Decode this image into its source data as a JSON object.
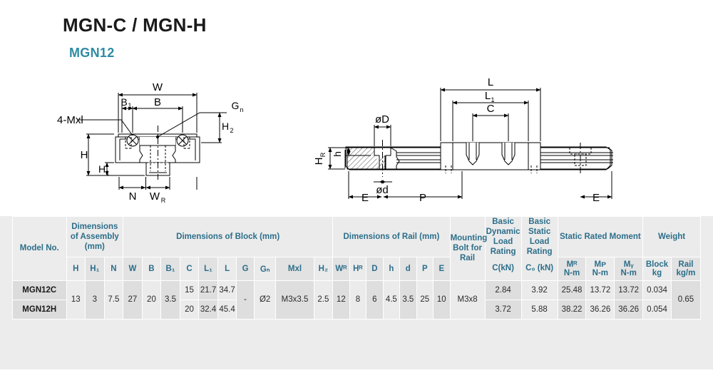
{
  "header": {
    "title": "MGN-C / MGN-H",
    "subtitle": "MGN12",
    "subtitle_color": "#2f8ba3"
  },
  "drawings": {
    "front_view": {
      "name": "block-cross-section",
      "labels": [
        "W",
        "B",
        "B₁",
        "Gₙ",
        "4-Mxl",
        "H₂",
        "H",
        "H₁",
        "N",
        "Wᴿ"
      ]
    },
    "side_view": {
      "name": "rail-side-view",
      "labels": [
        "L",
        "L₁",
        "C",
        "øD",
        "ød",
        "Hᴿ",
        "h",
        "E",
        "P",
        "E"
      ]
    }
  },
  "table": {
    "model_header": "Model No.",
    "groups": [
      {
        "label": "Dimensions of Assembly (mm)",
        "span": 3
      },
      {
        "label": "Dimensions of Block (mm)",
        "span": 10
      },
      {
        "label": "Dimensions of Rail (mm)",
        "span": 7
      },
      {
        "label": "Mounting Bolt for Rail",
        "span": 1
      },
      {
        "label": "Basic Dynamic Load Rating",
        "span": 1
      },
      {
        "label": "Basic Static Load Rating",
        "span": 1
      },
      {
        "label": "Static Rated Moment",
        "span": 3
      },
      {
        "label": "Weight",
        "span": 2
      }
    ],
    "sub_headers": [
      "H",
      "H₁",
      "N",
      "W",
      "B",
      "B₁",
      "C",
      "L₁",
      "L",
      "G",
      "Gₙ",
      "Mxl",
      "H₂",
      "Wᴿ",
      "Hᴿ",
      "D",
      "h",
      "d",
      "P",
      "E",
      "(mm)",
      "C(kN)",
      "C₀ (kN)",
      "Mᴿ",
      "Mᴘ",
      "Mᵧ",
      "Block",
      "Rail"
    ],
    "sub_units": {
      "MR": "N-m",
      "MP": "N-m",
      "MY": "N-m",
      "block": "kg",
      "rail": "kg/m"
    },
    "rows": [
      {
        "model": "MGN12C",
        "C": "15",
        "L1": "21.7",
        "L": "34.7",
        "Cd": "2.84",
        "C0": "3.92",
        "MR": "25.48",
        "MP": "13.72",
        "MY": "13.72",
        "block_weight": "0.034"
      },
      {
        "model": "MGN12H",
        "C": "20",
        "L1": "32.4",
        "L": "45.4",
        "Cd": "3.72",
        "C0": "5.88",
        "MR": "38.22",
        "MP": "36.26",
        "MY": "36.26",
        "block_weight": "0.054"
      }
    ],
    "shared": {
      "H": "13",
      "H1": "3",
      "N": "7.5",
      "W": "27",
      "B": "20",
      "B1": "3.5",
      "G": "-",
      "Gn": "Ø2",
      "Mxl": "M3x3.5",
      "H2": "2.5",
      "WR": "12",
      "HR": "8",
      "D": "6",
      "h": "4.5",
      "d": "3.5",
      "P": "25",
      "E": "10",
      "bolt": "M3x8",
      "rail_weight": "0.65"
    }
  }
}
